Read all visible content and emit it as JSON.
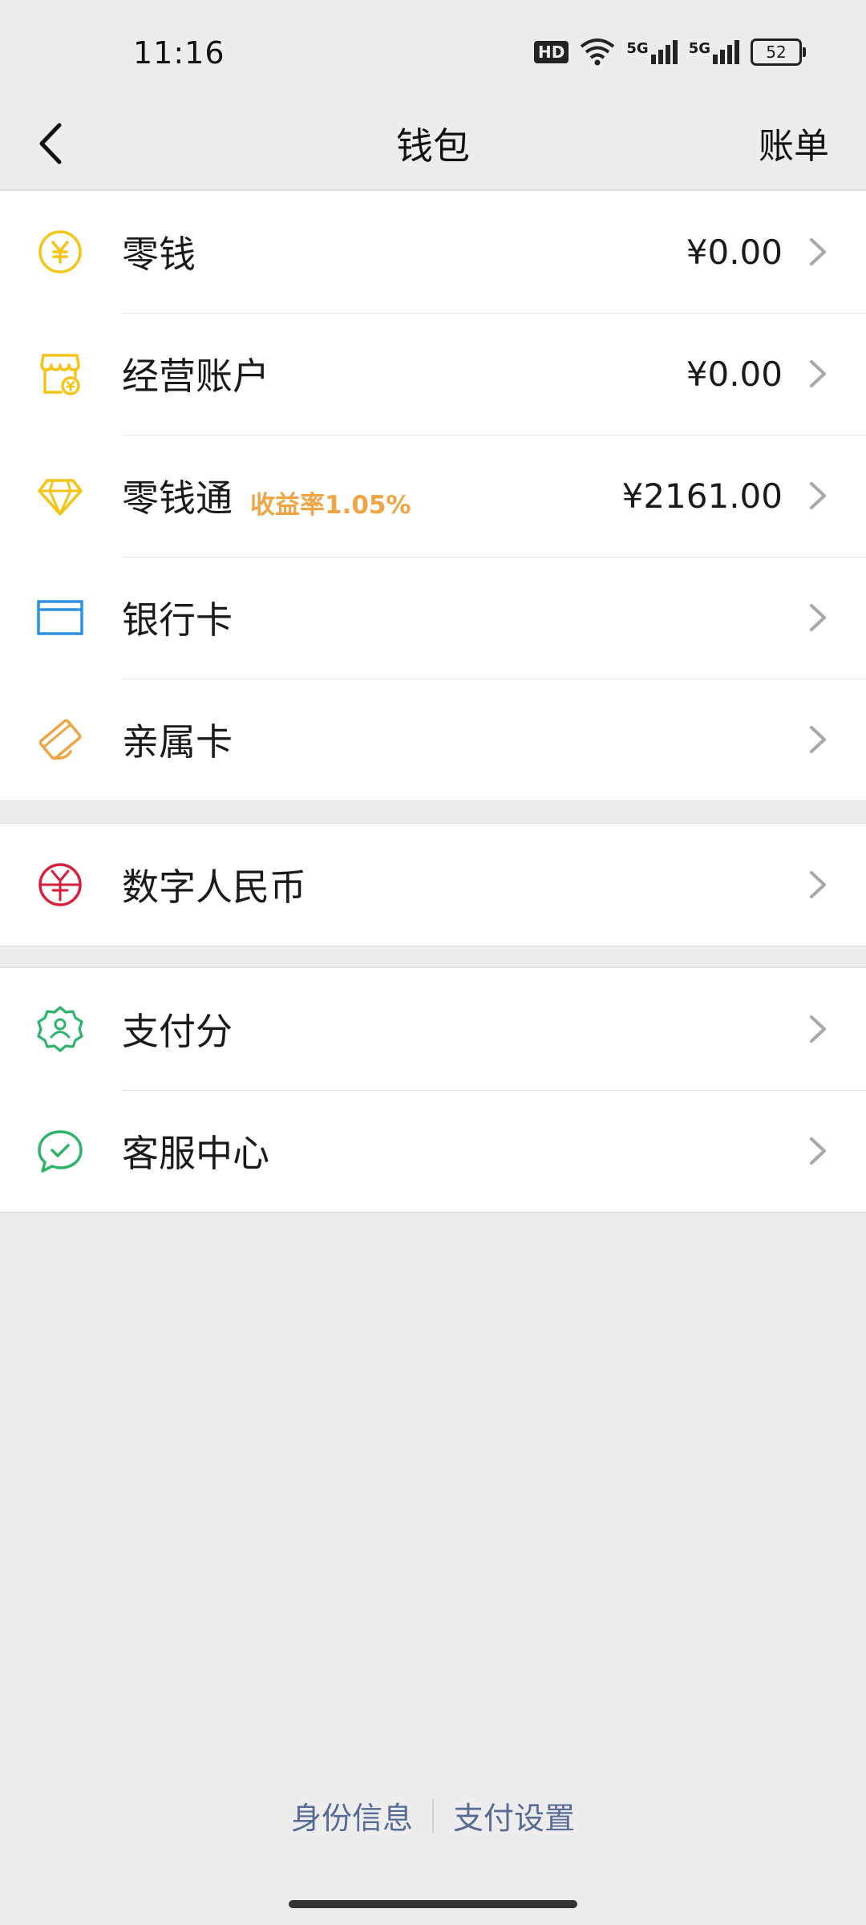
{
  "status_bar": {
    "time": "11:16",
    "hd": "HD",
    "network1": "5G",
    "network2": "5G",
    "battery": "52"
  },
  "header": {
    "title": "钱包",
    "bill_label": "账单"
  },
  "groups": [
    {
      "items": [
        {
          "label": "零钱",
          "value": "¥0.00",
          "icon": "yuan-coin-icon"
        },
        {
          "label": "经营账户",
          "value": "¥0.00",
          "icon": "shop-icon"
        },
        {
          "label": "零钱通",
          "tag": "收益率1.05%",
          "value": "¥2161.00",
          "icon": "diamond-icon"
        },
        {
          "label": "银行卡",
          "icon": "bank-card-icon"
        },
        {
          "label": "亲属卡",
          "icon": "family-card-icon"
        }
      ]
    },
    {
      "items": [
        {
          "label": "数字人民币",
          "icon": "digital-rmb-icon"
        }
      ]
    },
    {
      "items": [
        {
          "label": "支付分",
          "icon": "pay-score-icon"
        },
        {
          "label": "客服中心",
          "icon": "customer-service-icon"
        }
      ]
    }
  ],
  "footer": {
    "identity_label": "身份信息",
    "pay_settings_label": "支付设置"
  },
  "colors": {
    "background": "#ededed",
    "yellow_icon": "#f5c414",
    "orange_tag": "#f0a443",
    "blue_icon": "#2f8fe0",
    "red_icon": "#d81e3a",
    "green_icon": "#2db46b",
    "link": "#576b95"
  }
}
